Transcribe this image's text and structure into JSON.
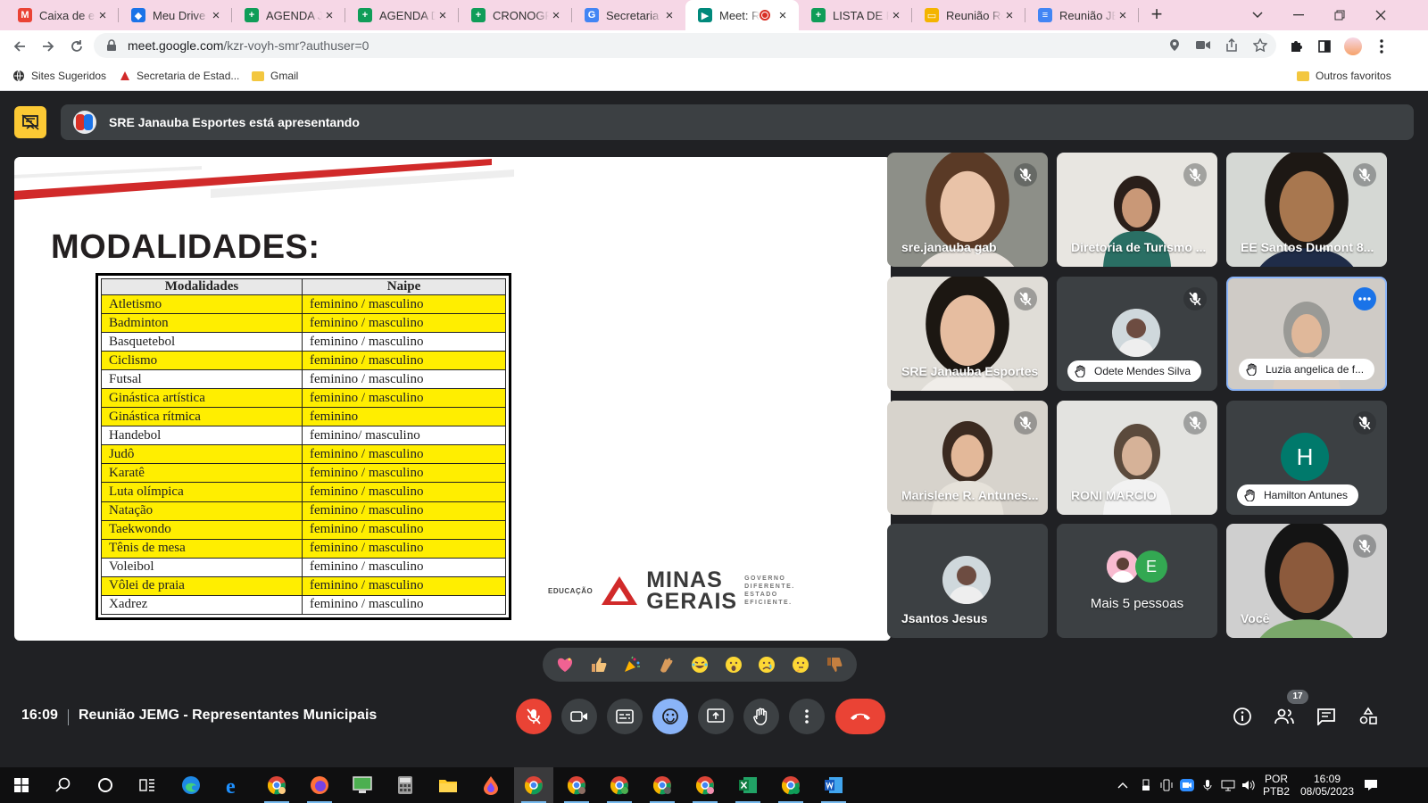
{
  "browser": {
    "tabs": [
      {
        "label": "Caixa de entrada",
        "icon": "gmail-icon",
        "color": "#ea4335",
        "letter": "M"
      },
      {
        "label": "Meu Drive - Google Drive",
        "icon": "drive-icon",
        "color": "#1a73e8",
        "letter": "◆"
      },
      {
        "label": "AGENDA Junho",
        "icon": "sheets-icon",
        "color": "#0f9d58",
        "letter": "+"
      },
      {
        "label": "AGENDA Diversos",
        "icon": "sheets-icon",
        "color": "#0f9d58",
        "letter": "+"
      },
      {
        "label": "CRONOGRAMA",
        "icon": "sheets-icon",
        "color": "#0f9d58",
        "letter": "+"
      },
      {
        "label": "Secretaria de Estado",
        "icon": "google-icon",
        "color": "#4285f4",
        "letter": "G"
      },
      {
        "label": "Meet: Reunião",
        "icon": "meet-icon",
        "color": "#00897b",
        "letter": "▶",
        "active": true
      },
      {
        "label": "LISTA DE PRESENÇA",
        "icon": "sheets-icon",
        "color": "#0f9d58",
        "letter": "+"
      },
      {
        "label": "Reunião Representantes",
        "icon": "slides-icon",
        "color": "#f4b400",
        "letter": "▭"
      },
      {
        "label": "Reunião JEMG",
        "icon": "docs-icon",
        "color": "#4285f4",
        "letter": "≡"
      }
    ],
    "url_host": "meet.google.com",
    "url_path": "/kzr-voyh-smr?authuser=0",
    "bookmarks": [
      {
        "label": "Sites Sugeridos"
      },
      {
        "label": "Secretaria de Estad..."
      },
      {
        "label": "Gmail"
      }
    ],
    "other_bookmarks": "Outros favoritos"
  },
  "meet": {
    "presenting_text": "SRE Janauba Esportes está apresentando",
    "slide": {
      "title": "MODALIDADES:",
      "table_headers": [
        "Modalidades",
        "Naipe"
      ],
      "rows": [
        {
          "mod": "Atletismo",
          "naipe": "feminino / masculino",
          "hl": true
        },
        {
          "mod": "Badminton",
          "naipe": "feminino / masculino",
          "hl": true
        },
        {
          "mod": "Basquetebol",
          "naipe": "feminino / masculino",
          "hl": false
        },
        {
          "mod": "Ciclismo",
          "naipe": "feminino / masculino",
          "hl": true
        },
        {
          "mod": "Futsal",
          "naipe": "feminino / masculino",
          "hl": false
        },
        {
          "mod": "Ginástica artística",
          "naipe": "feminino / masculino",
          "hl": true
        },
        {
          "mod": "Ginástica rítmica",
          "naipe": "feminino",
          "hl": true
        },
        {
          "mod": "Handebol",
          "naipe": "feminino/ masculino",
          "hl": false
        },
        {
          "mod": "Judô",
          "naipe": "feminino / masculino",
          "hl": true
        },
        {
          "mod": "Karatê",
          "naipe": "feminino / masculino",
          "hl": true
        },
        {
          "mod": "Luta olímpica",
          "naipe": "feminino / masculino",
          "hl": true
        },
        {
          "mod": "Natação",
          "naipe": "feminino / masculino",
          "hl": true
        },
        {
          "mod": "Taekwondo",
          "naipe": "feminino / masculino",
          "hl": true
        },
        {
          "mod": "Tênis de mesa",
          "naipe": "feminino / masculino",
          "hl": true
        },
        {
          "mod": "Voleibol",
          "naipe": "feminino / masculino",
          "hl": false
        },
        {
          "mod": "Vôlei de praia",
          "naipe": "feminino / masculino",
          "hl": true
        },
        {
          "mod": "Xadrez",
          "naipe": "feminino / masculino",
          "hl": false
        }
      ],
      "logo_edu": "EDUCAÇÃO",
      "logo_line1": "MINAS",
      "logo_line2": "GERAIS",
      "logo_tag": [
        "GOVERNO",
        "DIFERENTE.",
        "ESTADO",
        "EFICIENTE."
      ]
    },
    "participants": [
      {
        "name": "sre.janauba gab",
        "type": "video",
        "muted": true
      },
      {
        "name": "Diretoria de Turismo ...",
        "type": "video",
        "muted": true
      },
      {
        "name": "EE Santos Dumont 8...",
        "type": "video",
        "muted": true
      },
      {
        "name": "SRE Janauba Esportes",
        "type": "video",
        "muted": true
      },
      {
        "name": "Odete Mendes Silva",
        "type": "avatar-pill",
        "muted": true
      },
      {
        "name": "Luzia angelica de f...",
        "type": "video-pill",
        "muted": false
      },
      {
        "name": "Marislene R. Antunes...",
        "type": "video",
        "muted": true
      },
      {
        "name": "RONI MARCIO",
        "type": "video",
        "muted": true
      },
      {
        "name": "Hamilton Antunes",
        "type": "letter-pill",
        "letter": "H",
        "muted": true
      },
      {
        "name": "Jsantos Jesus",
        "type": "avatar",
        "muted": false
      },
      {
        "name": "Mais 5 pessoas",
        "type": "more",
        "letter": "E",
        "muted": false
      },
      {
        "name": "Você",
        "type": "video",
        "muted": true
      }
    ],
    "time": "16:09",
    "meeting_title": "Reunião JEMG - Representantes Municipais",
    "people_count": "17",
    "reactions": [
      "sparkling-heart",
      "thumbs-up",
      "party-popper",
      "clapping-hands",
      "joy",
      "open-mouth",
      "sad",
      "thinking",
      "thumbs-down"
    ]
  },
  "taskbar": {
    "lang1": "POR",
    "lang2": "PTB2",
    "time": "16:09",
    "date": "08/05/2023"
  },
  "colors": {
    "meet_bg": "#202124",
    "tile_bg": "#3c4043",
    "highlight_yellow": "#ffee00",
    "end_call_red": "#ea4335",
    "presenting_yellow": "#fcc934"
  }
}
